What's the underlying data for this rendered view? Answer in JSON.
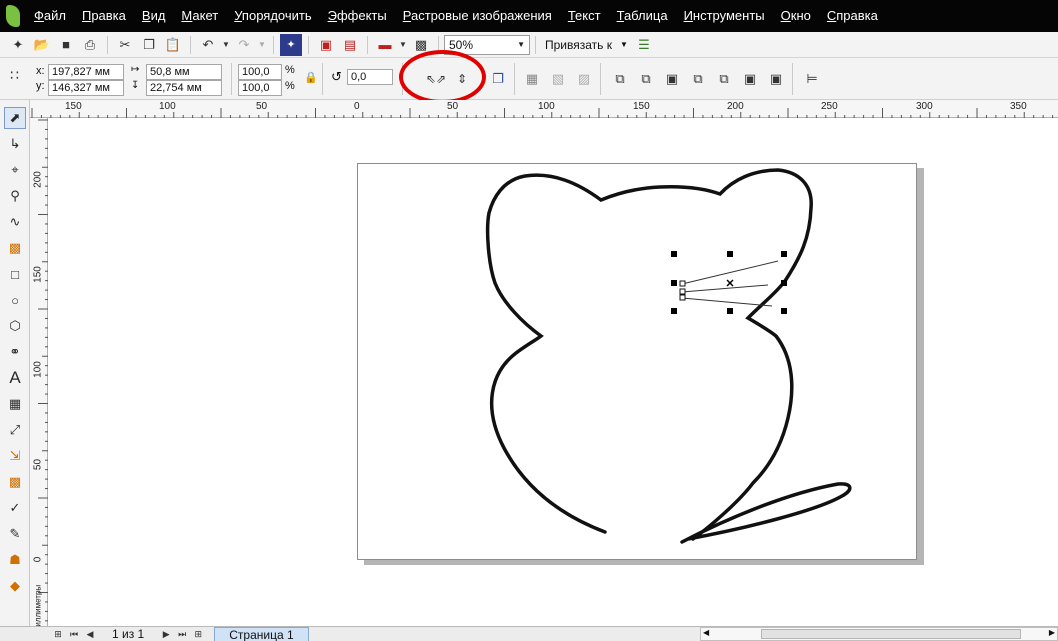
{
  "menu": [
    "Файл",
    "Правка",
    "Вид",
    "Макет",
    "Упорядочить",
    "Эффекты",
    "Растровые изображения",
    "Текст",
    "Таблица",
    "Инструменты",
    "Окно",
    "Справка"
  ],
  "toolbar": {
    "zoom_value": "50%",
    "snap_label": "Привязать к"
  },
  "property_bar": {
    "x_label": "x:",
    "x_value": "197,827 мм",
    "y_label": "y:",
    "y_value": "146,327 мм",
    "width_value": "50,8 мм",
    "height_value": "22,754 мм",
    "scale_x": "100,0",
    "scale_y": "100,0",
    "percent": "%",
    "rotation": "0,0"
  },
  "ruler_h_labels": [
    "150",
    "100",
    "50",
    "0",
    "50",
    "100",
    "150",
    "200",
    "250",
    "300",
    "350"
  ],
  "ruler_v_labels": [
    "200",
    "150",
    "100",
    "50",
    "0"
  ],
  "ruler_units": "миллиметры",
  "page_nav": {
    "page_count": "1 из 1",
    "page_tab": "Страница 1"
  },
  "colors": {
    "menubar": "#050505",
    "highlight_circle": "#e00000",
    "page_tab": "#cfe2f6"
  }
}
